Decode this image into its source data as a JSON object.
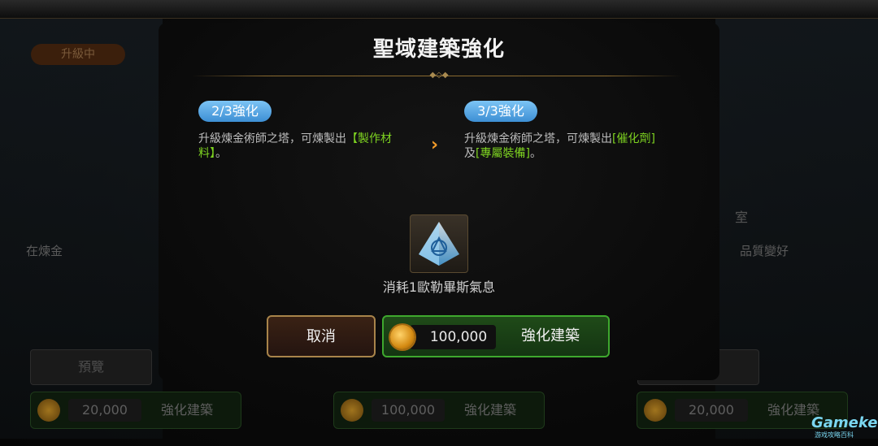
{
  "dialog": {
    "title": "聖域建築強化",
    "current": {
      "level": "2/3強化",
      "desc_prefix": "升級煉金術師之塔，可煉製出",
      "desc_highlight": "【製作材料】",
      "desc_suffix": "。"
    },
    "next": {
      "level": "3/3強化",
      "desc_prefix": "升級煉金術師之塔，可煉製出",
      "desc_highlight1": "[催化劑]",
      "desc_mid": "及",
      "desc_highlight2": "[專屬裝備]",
      "desc_suffix": "。"
    },
    "consume_text": "消耗1歐勒畢斯氣息",
    "cancel_label": "取消",
    "upgrade_cost": "100,000",
    "upgrade_label": "強化建築"
  },
  "background": {
    "badge": "升級中",
    "left_text": "在煉金",
    "right_room": "室",
    "right_text": "品質變好",
    "preview_label": "預覽",
    "cards": [
      {
        "cost": "20,000",
        "label": "強化建築"
      },
      {
        "cost": "100,000",
        "label": "強化建築"
      },
      {
        "cost": "20,000",
        "label": "強化建築"
      }
    ]
  },
  "watermark": {
    "logo": "Gamekee",
    "sub": "游戏攻略百科"
  },
  "colors": {
    "accent_green": "#7ed321",
    "pill_blue": "#4a9be0",
    "arrow_orange": "#f39c2a"
  }
}
